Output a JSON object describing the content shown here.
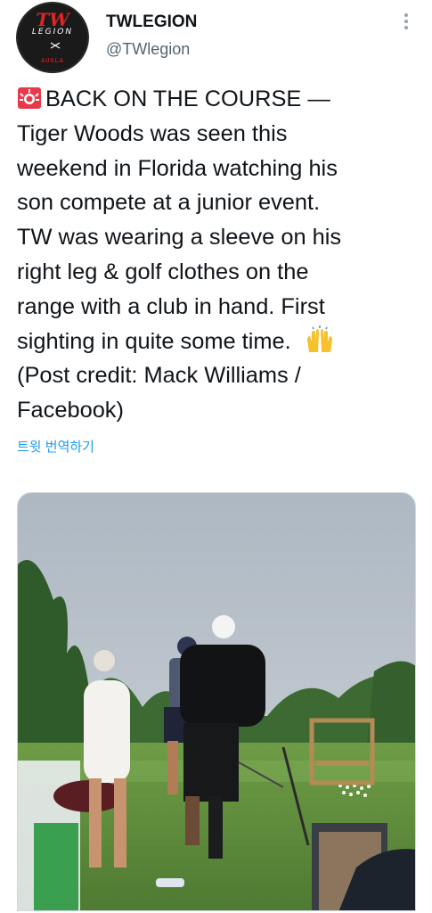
{
  "account": {
    "display_name": "TWLEGION",
    "handle": "@TWlegion",
    "avatar": {
      "line1": "TW",
      "line2": "LEGION",
      "line3": "AUGLA"
    }
  },
  "tweet": {
    "alert_icon": "police-car-light-emoji",
    "lines": [
      "BACK ON THE COURSE —",
      "Tiger Woods was seen this",
      "weekend in Florida watching his",
      "son compete at a junior event.",
      "TW was wearing a sleeve on his",
      "right leg & golf clothes on the",
      "range with a club in hand. First",
      "sighting in quite some time."
    ],
    "raising_hands_icon": "raising-hands-emoji",
    "credit_lines": [
      "(Post credit: Mack Williams /",
      "Facebook)"
    ],
    "translate_label": "트윗 번역하기"
  },
  "media": {
    "description": "photo",
    "colors": {
      "sky": "#b9c3cd",
      "grass": "#5f8f3e",
      "trees": "#2f5a2a"
    }
  },
  "colors": {
    "link": "#1d9bf0",
    "secondary": "#536471",
    "text": "#0f1419"
  }
}
